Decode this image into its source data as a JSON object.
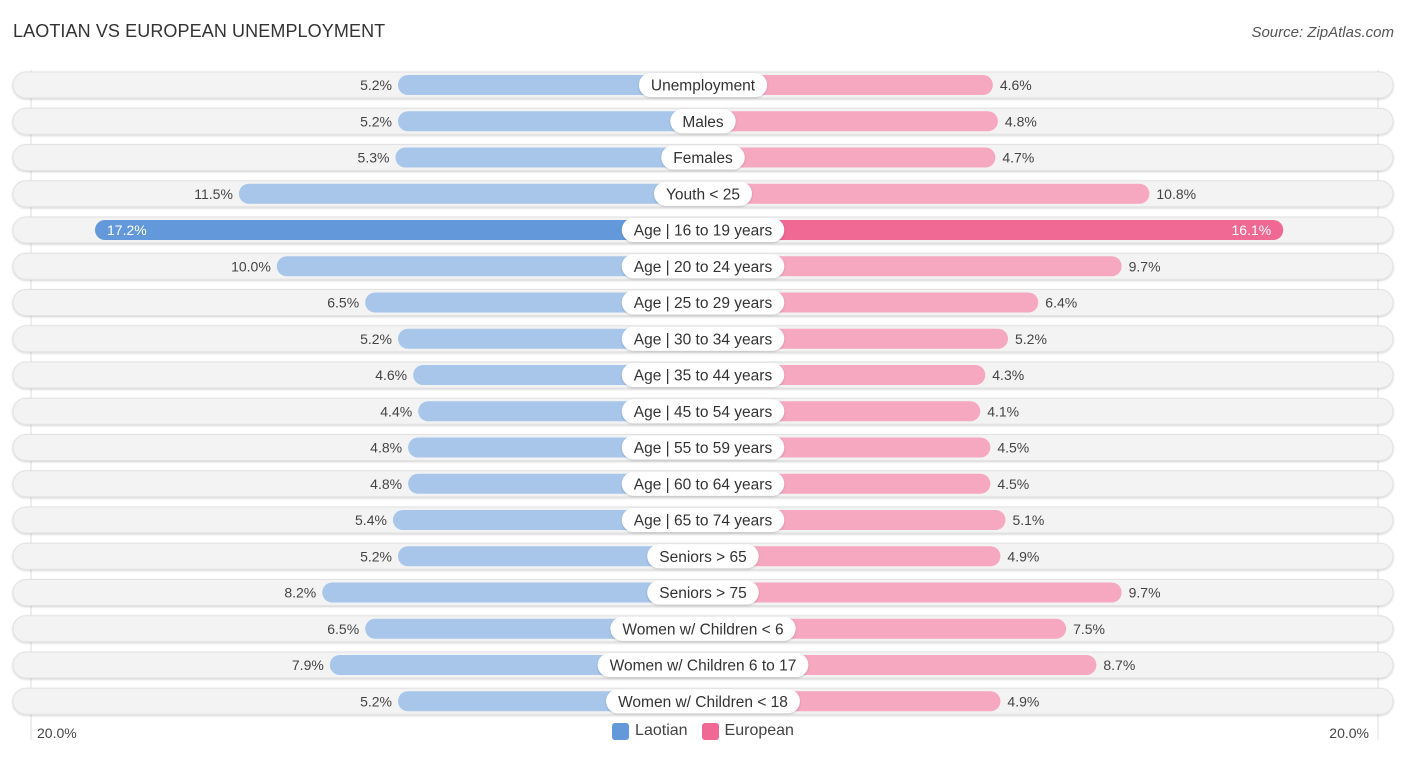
{
  "header": {
    "title": "LAOTIAN VS EUROPEAN UNEMPLOYMENT",
    "source": "Source: ZipAtlas.com"
  },
  "colors": {
    "laotian": "#a7c6ea",
    "laotian_strong": "#6399da",
    "european": "#f5a8c0",
    "european_strong": "#f06894",
    "row_bg": "#f3f3f3"
  },
  "chart_data": {
    "type": "bar",
    "orientation": "horizontal-diverging",
    "title": "LAOTIAN VS EUROPEAN UNEMPLOYMENT",
    "xlabel": "",
    "ylabel": "",
    "unit": "%",
    "axis_min_label": "20.0%",
    "axis_max_label": "20.0%",
    "xlim": [
      -20,
      20
    ],
    "legend_position": "bottom",
    "categories": [
      "Unemployment",
      "Males",
      "Females",
      "Youth < 25",
      "Age | 16 to 19 years",
      "Age | 20 to 24 years",
      "Age | 25 to 29 years",
      "Age | 30 to 34 years",
      "Age | 35 to 44 years",
      "Age | 45 to 54 years",
      "Age | 55 to 59 years",
      "Age | 60 to 64 years",
      "Age | 65 to 74 years",
      "Seniors > 65",
      "Seniors > 75",
      "Women w/ Children < 6",
      "Women w/ Children 6 to 17",
      "Women w/ Children < 18"
    ],
    "series": [
      {
        "name": "Laotian",
        "side": "left",
        "values": [
          5.2,
          5.2,
          5.3,
          11.5,
          17.2,
          10.0,
          6.5,
          5.2,
          4.6,
          4.4,
          4.8,
          4.8,
          5.4,
          5.2,
          8.2,
          6.5,
          7.9,
          5.2
        ],
        "labels": [
          "5.2%",
          "5.2%",
          "5.3%",
          "11.5%",
          "17.2%",
          "10.0%",
          "6.5%",
          "5.2%",
          "4.6%",
          "4.4%",
          "4.8%",
          "4.8%",
          "5.4%",
          "5.2%",
          "8.2%",
          "6.5%",
          "7.9%",
          "5.2%"
        ]
      },
      {
        "name": "European",
        "side": "right",
        "values": [
          4.6,
          4.8,
          4.7,
          10.8,
          16.1,
          9.7,
          6.4,
          5.2,
          4.3,
          4.1,
          4.5,
          4.5,
          5.1,
          4.9,
          9.7,
          7.5,
          8.7,
          4.9
        ],
        "labels": [
          "4.6%",
          "4.8%",
          "4.7%",
          "10.8%",
          "16.1%",
          "9.7%",
          "6.4%",
          "5.2%",
          "4.3%",
          "4.1%",
          "4.5%",
          "4.5%",
          "5.1%",
          "4.9%",
          "9.7%",
          "7.5%",
          "8.7%",
          "4.9%"
        ]
      }
    ]
  },
  "legend": {
    "items": [
      {
        "label": "Laotian"
      },
      {
        "label": "European"
      }
    ]
  }
}
